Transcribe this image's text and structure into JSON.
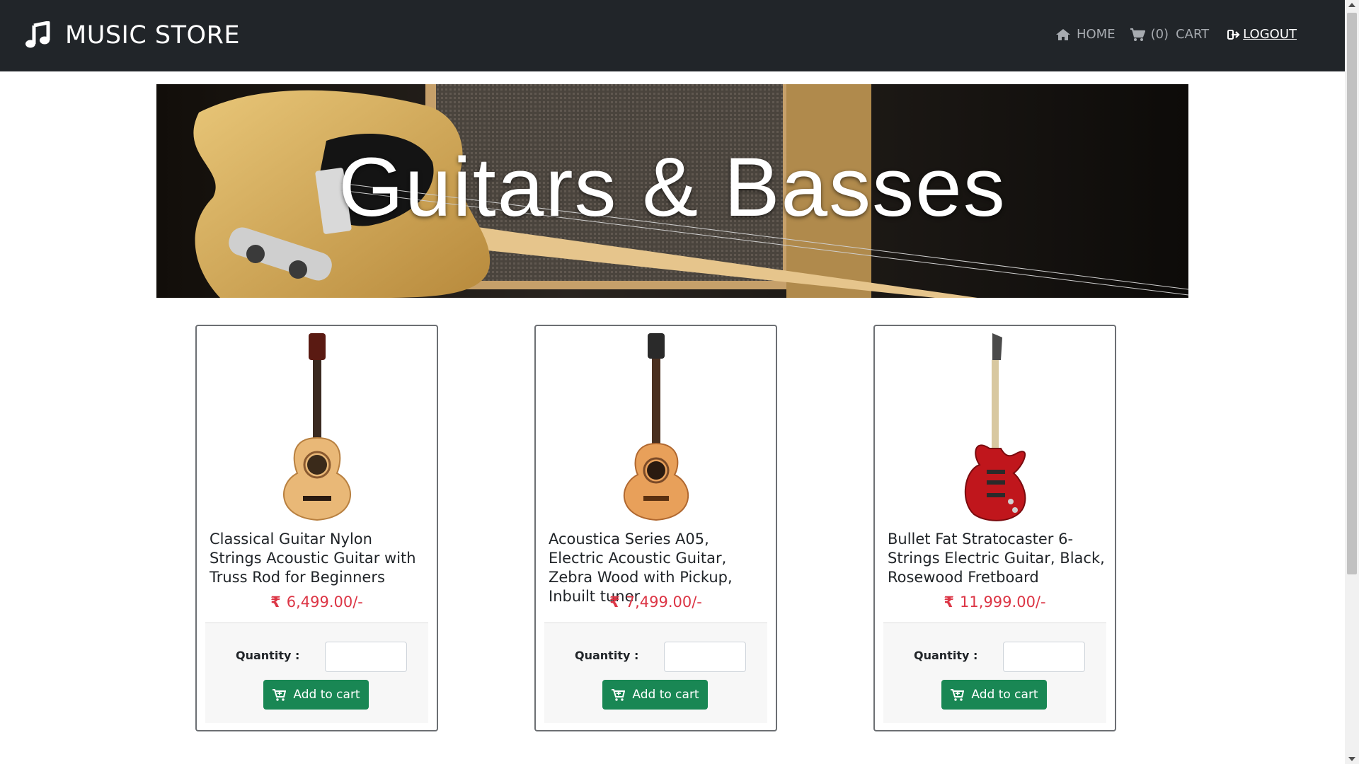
{
  "navbar": {
    "brand_icon": "music-note-icon",
    "brand": "MUSIC STORE",
    "home_icon": "home-icon",
    "home": "HOME",
    "cart_icon": "cart-icon",
    "cart_count": "(0)",
    "cart": "CART",
    "logout_icon": "sign-out-icon",
    "logout": "LOGOUT"
  },
  "banner": {
    "title": "Guitars & Basses"
  },
  "products": [
    {
      "title": "Classical Guitar Nylon Strings Acoustic Guitar with Truss Rod for Beginners",
      "currency": "₹",
      "price": "6,499.00/-",
      "quantity_label": "Quantity :",
      "quantity_value": "",
      "button": "Add to cart",
      "button_icon": "cart-plus-icon",
      "image": "classical-guitar-image"
    },
    {
      "title": "Acoustica Series A05, Electric Acoustic Guitar, Zebra Wood with Pickup, Inbuilt tuner",
      "currency": "₹",
      "price": "7,499.00/-",
      "quantity_label": "Quantity :",
      "quantity_value": "",
      "button": "Add to cart",
      "button_icon": "cart-plus-icon",
      "image": "acoustic-guitar-image"
    },
    {
      "title": "Bullet Fat Stratocaster 6-Strings Electric Guitar, Black, Rosewood Fretboard",
      "currency": "₹",
      "price": "11,999.00/-",
      "quantity_label": "Quantity :",
      "quantity_value": "",
      "button": "Add to cart",
      "button_icon": "cart-plus-icon",
      "image": "electric-guitar-image"
    }
  ],
  "colors": {
    "navbar_bg": "#212529",
    "price": "#dc3545",
    "button": "#198754"
  }
}
